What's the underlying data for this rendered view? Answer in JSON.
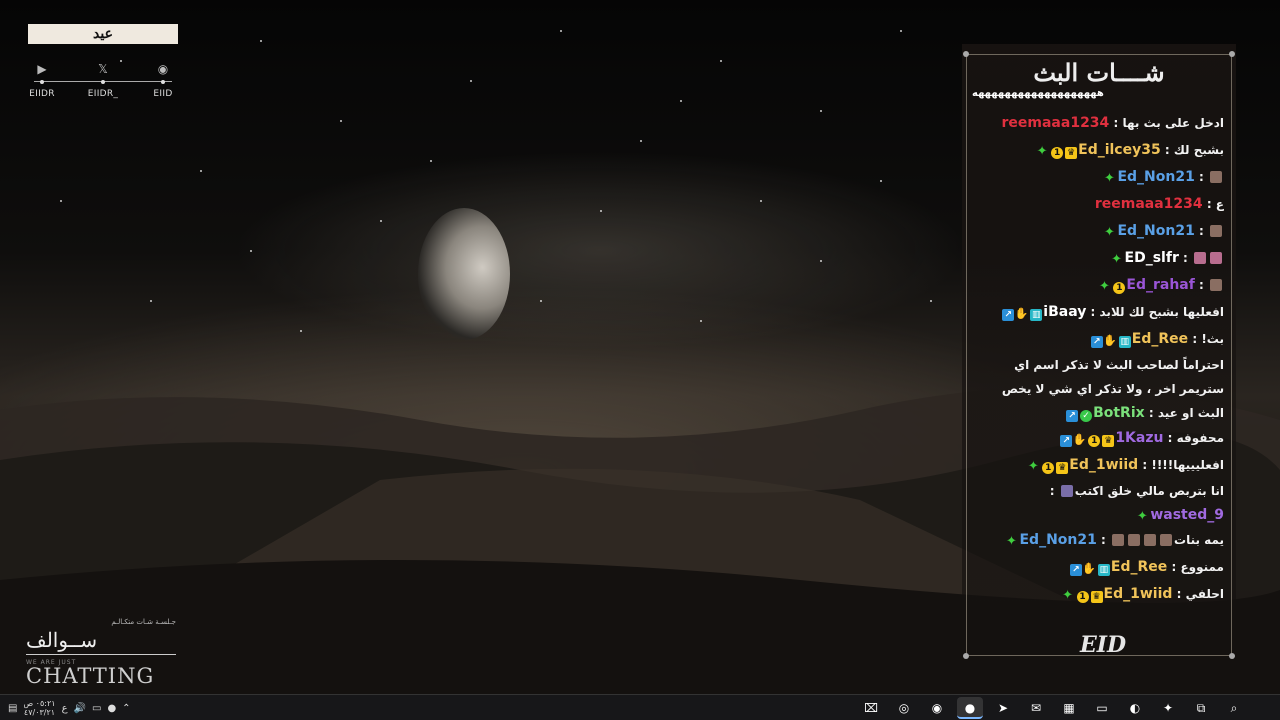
{
  "brand": {
    "title": "عيد"
  },
  "socials": [
    {
      "icon": "youtube-icon",
      "glyph": "▶",
      "label": "EIIDR"
    },
    {
      "icon": "x-icon",
      "glyph": "𝕏",
      "label": "EIIDR_"
    },
    {
      "icon": "discord-icon",
      "glyph": "◉",
      "label": "EIID"
    }
  ],
  "bottom_left": {
    "small": "جـلسـة شـات متكـالـم",
    "arabic": "ســوالف",
    "tagline": "WE ARE JUST",
    "big": "CHATTING"
  },
  "chat": {
    "title": "شــــات البث",
    "subtitle": "هههههههههههههههههههه",
    "logo": "EID",
    "messages": [
      {
        "user": "reemaaa1234",
        "color": "#e0303f",
        "badges": [],
        "text": "ادخل على بث بها",
        "emotes": 0
      },
      {
        "user": "Ed_ilcey35",
        "color": "#f0c35a",
        "badges": [
          "star",
          "one",
          "crown"
        ],
        "text": "بشبح لك",
        "emotes": 0
      },
      {
        "user": "Ed_Non21",
        "color": "#5aa0e6",
        "badges": [
          "star"
        ],
        "text": "",
        "emotes": 1
      },
      {
        "user": "reemaaa1234",
        "color": "#e0303f",
        "badges": [],
        "text": "ع",
        "emotes": 0
      },
      {
        "user": "Ed_Non21",
        "color": "#5aa0e6",
        "badges": [
          "star"
        ],
        "text": "",
        "emotes": 1
      },
      {
        "user": "ED_slfr",
        "color": "#ffffff",
        "badges": [
          "star"
        ],
        "text": "",
        "emotes": 2
      },
      {
        "user": "Ed_rahaf",
        "color": "#9a55d6",
        "badges": [
          "star",
          "one"
        ],
        "text": "",
        "emotes": 1
      },
      {
        "user": "iBaay",
        "color": "#ffffff",
        "badges": [
          "arrow",
          "hand",
          "pair"
        ],
        "text": "افعليها بشبح لك للابد",
        "emotes": 0
      },
      {
        "user": "Ed_Ree",
        "color": "#f0c35a",
        "badges": [
          "arrow",
          "hand",
          "pair"
        ],
        "text": "بث!",
        "emotes": 0
      },
      {
        "user": "BotRix",
        "color": "#7be07b",
        "badges": [
          "arrow",
          "check"
        ],
        "text": "احتراماً لصاحب البث لا تذكر اسم اي ستريمر اخر ، ولا تذكر اي شي لا يخص البث او عيد",
        "emotes": 0,
        "multi": true
      },
      {
        "user": "1Kazu",
        "color": "#a06ae0",
        "badges": [
          "arrow",
          "hand",
          "one",
          "crown"
        ],
        "text": "محفوفه",
        "emotes": 0
      },
      {
        "user": "Ed_1wiid",
        "color": "#f0c35a",
        "badges": [
          "star",
          "one",
          "crown"
        ],
        "text": "افعليييها!!!!",
        "emotes": 0
      },
      {
        "user": "wasted_9",
        "color": "#a06ae0",
        "badges": [
          "star"
        ],
        "text": "انا بتربص مالي خلق اكتب",
        "emotes": 1,
        "multi": true
      },
      {
        "user": "Ed_Non21",
        "color": "#5aa0e6",
        "badges": [
          "star"
        ],
        "text": "يمه بنات",
        "emotes": 4
      },
      {
        "user": "Ed_Ree",
        "color": "#f0c35a",
        "badges": [
          "arrow",
          "hand",
          "pair"
        ],
        "text": "ممنووع",
        "emotes": 0
      },
      {
        "user": "Ed_1wiid",
        "color": "#f0c35a",
        "badges": [
          "star",
          "one",
          "crown"
        ],
        "text": "احلفي",
        "emotes": 0
      }
    ]
  },
  "taskbar": {
    "time": "٠٥:٢١ ص",
    "date": "٤٧/٠٣/٢١",
    "lang": "ع",
    "apps": [
      {
        "name": "snipping-tool-icon",
        "glyph": "⌧"
      },
      {
        "name": "obs-icon",
        "glyph": "◎"
      },
      {
        "name": "discord-icon",
        "glyph": "◉"
      },
      {
        "name": "chrome-icon",
        "glyph": "●",
        "active": true
      },
      {
        "name": "telegram-icon",
        "glyph": "➤"
      },
      {
        "name": "outlook-icon",
        "glyph": "✉"
      },
      {
        "name": "store-icon",
        "glyph": "▦"
      },
      {
        "name": "explorer-icon",
        "glyph": "▭"
      },
      {
        "name": "edge-icon",
        "glyph": "◐"
      },
      {
        "name": "copilot-icon",
        "glyph": "✦"
      },
      {
        "name": "taskview-icon",
        "glyph": "⧉"
      },
      {
        "name": "search-icon",
        "glyph": "⌕"
      }
    ]
  }
}
